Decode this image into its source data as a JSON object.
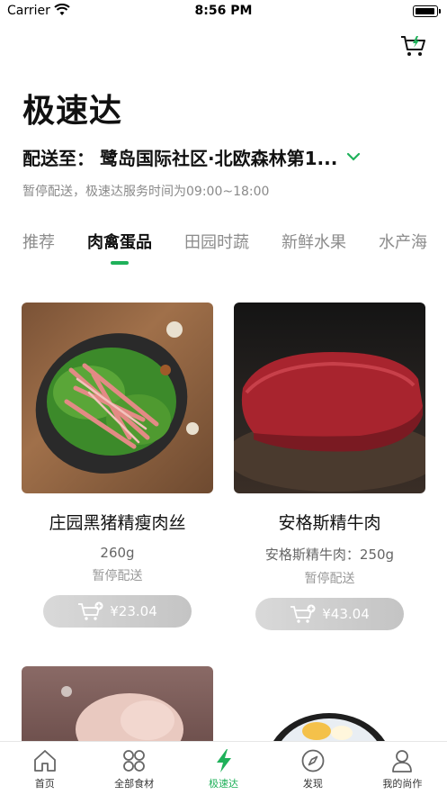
{
  "status_bar": {
    "carrier": "Carrier",
    "time": "8:56 PM"
  },
  "header": {
    "title": "极速达",
    "delivery_prefix": "配送至：",
    "delivery_address": "鹭岛国际社区·北欧森林第1...",
    "service_notice": "暂停配送，极速达服务时间为09:00~18:00"
  },
  "tabs": [
    {
      "label": "推荐"
    },
    {
      "label": "肉禽蛋品"
    },
    {
      "label": "田园时蔬"
    },
    {
      "label": "新鲜水果"
    },
    {
      "label": "水产海"
    }
  ],
  "active_tab": "肉禽蛋品",
  "products": [
    {
      "name": "庄园黑猪精瘦肉丝",
      "spec": "260g",
      "status": "暂停配送",
      "price": "¥23.04"
    },
    {
      "name": "安格斯精牛肉",
      "spec": "安格斯精牛肉：250g",
      "status": "暂停配送",
      "price": "¥43.04"
    }
  ],
  "bottom_nav": [
    {
      "label": "首页",
      "icon": "home-icon"
    },
    {
      "label": "全部食材",
      "icon": "grid-icon"
    },
    {
      "label": "极速达",
      "icon": "lightning-icon"
    },
    {
      "label": "发现",
      "icon": "compass-icon"
    },
    {
      "label": "我的尚作",
      "icon": "user-icon"
    }
  ],
  "colors": {
    "accent": "#1fb15a",
    "muted_text": "#8a8a8a",
    "button_disabled": "#cccccc"
  }
}
